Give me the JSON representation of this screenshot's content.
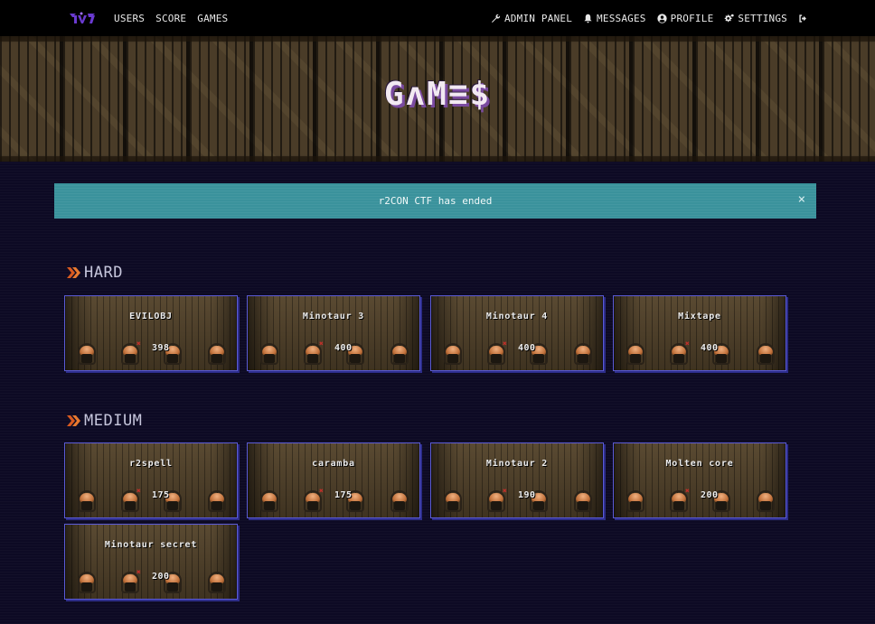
{
  "nav": {
    "left": [
      "USERS",
      "SCORE",
      "GAMES"
    ],
    "right": {
      "admin": "ADMIN PANEL",
      "messages": "MESSAGES",
      "profile": "PROFILE",
      "settings": "SETTINGS"
    }
  },
  "hero": {
    "title": "GʌM≡$"
  },
  "alert": {
    "text": "r2CON CTF has ended",
    "close": "×"
  },
  "sections": [
    {
      "title": "HARD",
      "games": [
        {
          "name": "EVILOBJ",
          "score": "398"
        },
        {
          "name": "Minotaur 3",
          "score": "400"
        },
        {
          "name": "Minotaur 4",
          "score": "400"
        },
        {
          "name": "Mixtape",
          "score": "400"
        }
      ]
    },
    {
      "title": "MEDIUM",
      "games": [
        {
          "name": "r2spell",
          "score": "175"
        },
        {
          "name": "caramba",
          "score": "175"
        },
        {
          "name": "Minotaur 2",
          "score": "190"
        },
        {
          "name": "Molten core",
          "score": "200"
        },
        {
          "name": "Minotaur secret",
          "score": "200"
        }
      ]
    }
  ],
  "colors": {
    "background": "#0d0a24",
    "alert": "#3a929c",
    "card_border": "#5b5bd6",
    "chevron": "#d85a20"
  }
}
